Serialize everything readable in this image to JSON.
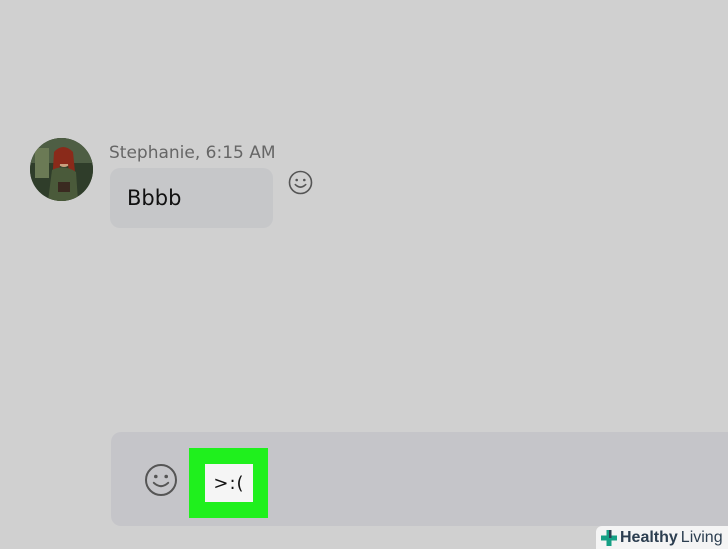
{
  "message": {
    "sender": "Stephanie, 6:15 AM",
    "text": "Bbbb"
  },
  "composer": {
    "emoticon": ">:("
  },
  "watermark": {
    "brand_bold": "Healthy",
    "brand_light": "Living"
  },
  "icons": {
    "reaction": "smiley-icon",
    "composer_emoji": "smiley-icon",
    "watermark": "cross-icon"
  },
  "colors": {
    "background": "#d0d0d0",
    "bubble": "#c6c7c9",
    "composer": "#c5c5c9",
    "highlight": "#1ff01d",
    "watermark_cross": "#16a085"
  }
}
